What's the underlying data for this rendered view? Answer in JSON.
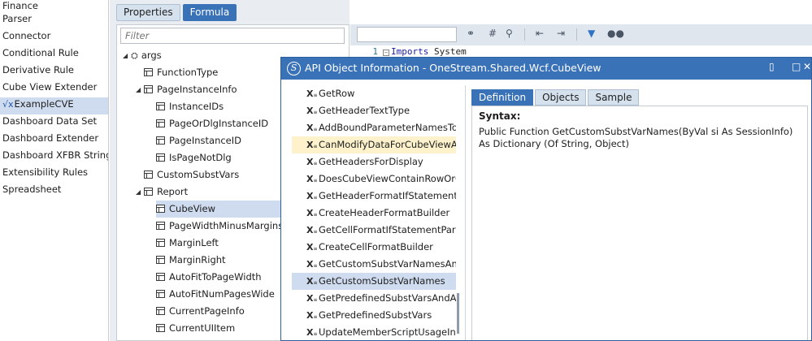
{
  "nav": {
    "items": [
      {
        "label": "Finance"
      },
      {
        "label": "Parser"
      },
      {
        "label": "Connector"
      },
      {
        "label": "Conditional Rule"
      },
      {
        "label": "Derivative Rule"
      },
      {
        "label": "Cube View Extender"
      },
      {
        "label": "ExampleCVE",
        "icon": "sqrt-x-icon",
        "selected": true
      },
      {
        "label": "Dashboard Data Set"
      },
      {
        "label": "Dashboard Extender"
      },
      {
        "label": "Dashboard XFBR String"
      },
      {
        "label": "Extensibility Rules"
      },
      {
        "label": "Spreadsheet"
      }
    ]
  },
  "middle": {
    "tabs": [
      {
        "label": "Properties",
        "active": false
      },
      {
        "label": "Formula",
        "active": true
      }
    ],
    "filter_placeholder": "Filter",
    "tree": [
      {
        "label": "args",
        "level": 0,
        "caret": "expanded",
        "icon": "args"
      },
      {
        "label": "FunctionType",
        "level": 1,
        "icon": "prop"
      },
      {
        "label": "PageInstanceInfo",
        "level": 1,
        "caret": "expanded",
        "icon": "prop"
      },
      {
        "label": "InstanceIDs",
        "level": 2,
        "icon": "prop"
      },
      {
        "label": "PageOrDlgInstanceID",
        "level": 2,
        "icon": "prop"
      },
      {
        "label": "PageInstanceID",
        "level": 2,
        "icon": "prop"
      },
      {
        "label": "IsPageNotDlg",
        "level": 2,
        "icon": "prop"
      },
      {
        "label": "CustomSubstVars",
        "level": 1,
        "icon": "prop"
      },
      {
        "label": "Report",
        "level": 1,
        "caret": "expanded",
        "icon": "prop"
      },
      {
        "label": "CubeView",
        "level": 2,
        "icon": "prop",
        "selected": true
      },
      {
        "label": "PageWidthMinusMargins",
        "level": 2,
        "icon": "prop"
      },
      {
        "label": "MarginLeft",
        "level": 2,
        "icon": "prop"
      },
      {
        "label": "MarginRight",
        "level": 2,
        "icon": "prop"
      },
      {
        "label": "AutoFitToPageWidth",
        "level": 2,
        "icon": "prop"
      },
      {
        "label": "AutoFitNumPagesWide",
        "level": 2,
        "icon": "prop"
      },
      {
        "label": "CurrentPageInfo",
        "level": 2,
        "icon": "prop"
      },
      {
        "label": "CurrentUIItem",
        "level": 2,
        "icon": "prop"
      }
    ]
  },
  "editor": {
    "toolbar_icons": [
      "binoculars-icon",
      "hash-icon",
      "find-replace-icon",
      "outdent-icon",
      "indent-icon",
      "filter-icon",
      "glasses-icon"
    ],
    "code": {
      "line_number": "1",
      "keyword": "Imports",
      "text": "System"
    }
  },
  "dialog": {
    "title": "API Object Information - OneStream.Shared.Wcf.CubeView",
    "methods": [
      {
        "label": "GetRow"
      },
      {
        "label": "GetHeaderTextType"
      },
      {
        "label": "AddBoundParameterNamesToD"
      },
      {
        "label": "CanModifyDataForCubeViewAn",
        "hover": true
      },
      {
        "label": "GetHeadersForDisplay"
      },
      {
        "label": "DoesCubeViewContainRowOrCo"
      },
      {
        "label": "GetHeaderFormatIfStatementPa"
      },
      {
        "label": "CreateHeaderFormatBuilder"
      },
      {
        "label": "GetCellFormatIfStatementParser"
      },
      {
        "label": "CreateCellFormatBuilder"
      },
      {
        "label": "GetCustomSubstVarNamesAndA"
      },
      {
        "label": "GetCustomSubstVarNames",
        "selected": true
      },
      {
        "label": "GetPredefinedSubstVarsAndAdd"
      },
      {
        "label": "GetPredefinedSubstVars"
      },
      {
        "label": "UpdateMemberScriptUsageInfo"
      }
    ],
    "tabs": [
      {
        "label": "Definition",
        "active": true
      },
      {
        "label": "Objects",
        "active": false
      },
      {
        "label": "Sample",
        "active": false
      }
    ],
    "syntax_label": "Syntax:",
    "syntax_text": "Public Function GetCustomSubstVarNames(ByVal si As SessionInfo) As Dictionary (Of String, Object)"
  },
  "colors": {
    "accent": "#3a72b8",
    "selection": "#cfdbee",
    "hover": "#fdf2cb"
  }
}
